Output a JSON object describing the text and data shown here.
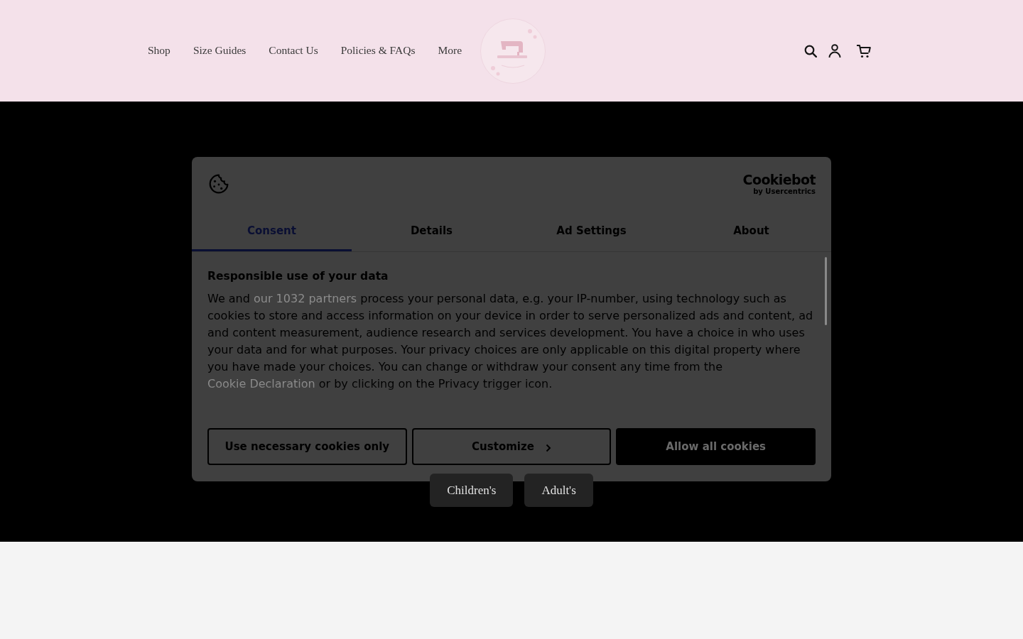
{
  "header": {
    "nav": [
      {
        "label": "Shop"
      },
      {
        "label": "Size Guides"
      },
      {
        "label": "Contact Us"
      },
      {
        "label": "Policies & FAQs"
      },
      {
        "label": "More"
      }
    ]
  },
  "cookie_dialog": {
    "brand": {
      "name": "Cookiebot",
      "byline": "by Usercentrics"
    },
    "tabs": [
      {
        "label": "Consent",
        "selected": true
      },
      {
        "label": "Details",
        "selected": false
      },
      {
        "label": "Ad Settings",
        "selected": false
      },
      {
        "label": "About",
        "selected": false
      }
    ],
    "heading": "Responsible use of your data",
    "body": [
      {
        "kind": "text",
        "text": "We and"
      },
      {
        "kind": "link",
        "text": "our 1032 partners"
      },
      {
        "kind": "text",
        "text": "process your personal data, e.g. your IP-number, using technology such as cookies to store and access information on your device in order to serve personalized ads and content, ad and content measurement, audience research and services development. You have a choice in who uses your data and for what purposes. Your privacy choices are only applicable on this digital property where you have made your choices. You can change or withdraw your consent any time from the"
      },
      {
        "kind": "link",
        "text": "Cookie Declaration"
      },
      {
        "kind": "text",
        "text": "or by clicking on the Privacy trigger icon."
      }
    ],
    "buttons": [
      {
        "label": "Use necessary cookies only",
        "kind": "outline"
      },
      {
        "label": "Customize",
        "kind": "expand"
      },
      {
        "label": "Allow all cookies",
        "kind": "solid"
      }
    ]
  },
  "hero": {
    "buttons": [
      {
        "label": "Children's"
      },
      {
        "label": "Adult's"
      }
    ]
  }
}
